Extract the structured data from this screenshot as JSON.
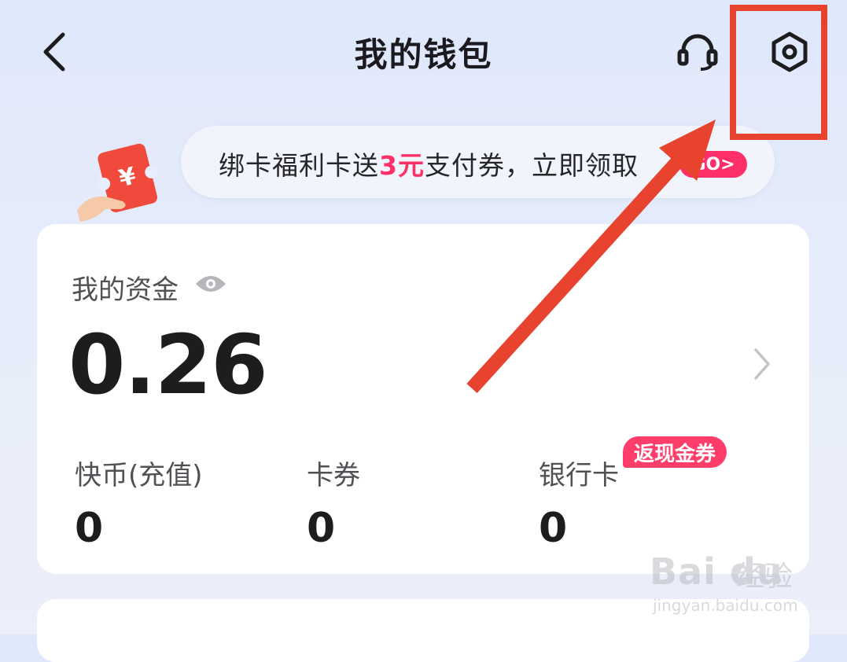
{
  "header": {
    "title": "我的钱包",
    "back_icon": "chevron-left-icon",
    "support_icon": "headset-icon",
    "settings_icon": "hexagon-settings-icon"
  },
  "promo": {
    "text_before": "绑卡福利",
    "text_partial": "卡送",
    "text_highlight": "3元",
    "text_after": "支付券，立即领取",
    "go_label": "GO>",
    "icon": "red-ticket-icon"
  },
  "funds": {
    "label": "我的资金",
    "amount": "0.26",
    "eye_icon": "eye-icon"
  },
  "stats": [
    {
      "label": "快币(充值)",
      "value": "0"
    },
    {
      "label": "卡券",
      "value": "0"
    },
    {
      "label": "银行卡",
      "value": "0"
    }
  ],
  "cashback_badge": "返现金券",
  "annotation": {
    "color": "#e8432f"
  },
  "watermark": {
    "logo": "Bai du",
    "cn": "经验",
    "url": "jingyan.baidu.com"
  },
  "colors": {
    "accent_pink": "#ff2f6a",
    "background": "#e3eafa"
  }
}
